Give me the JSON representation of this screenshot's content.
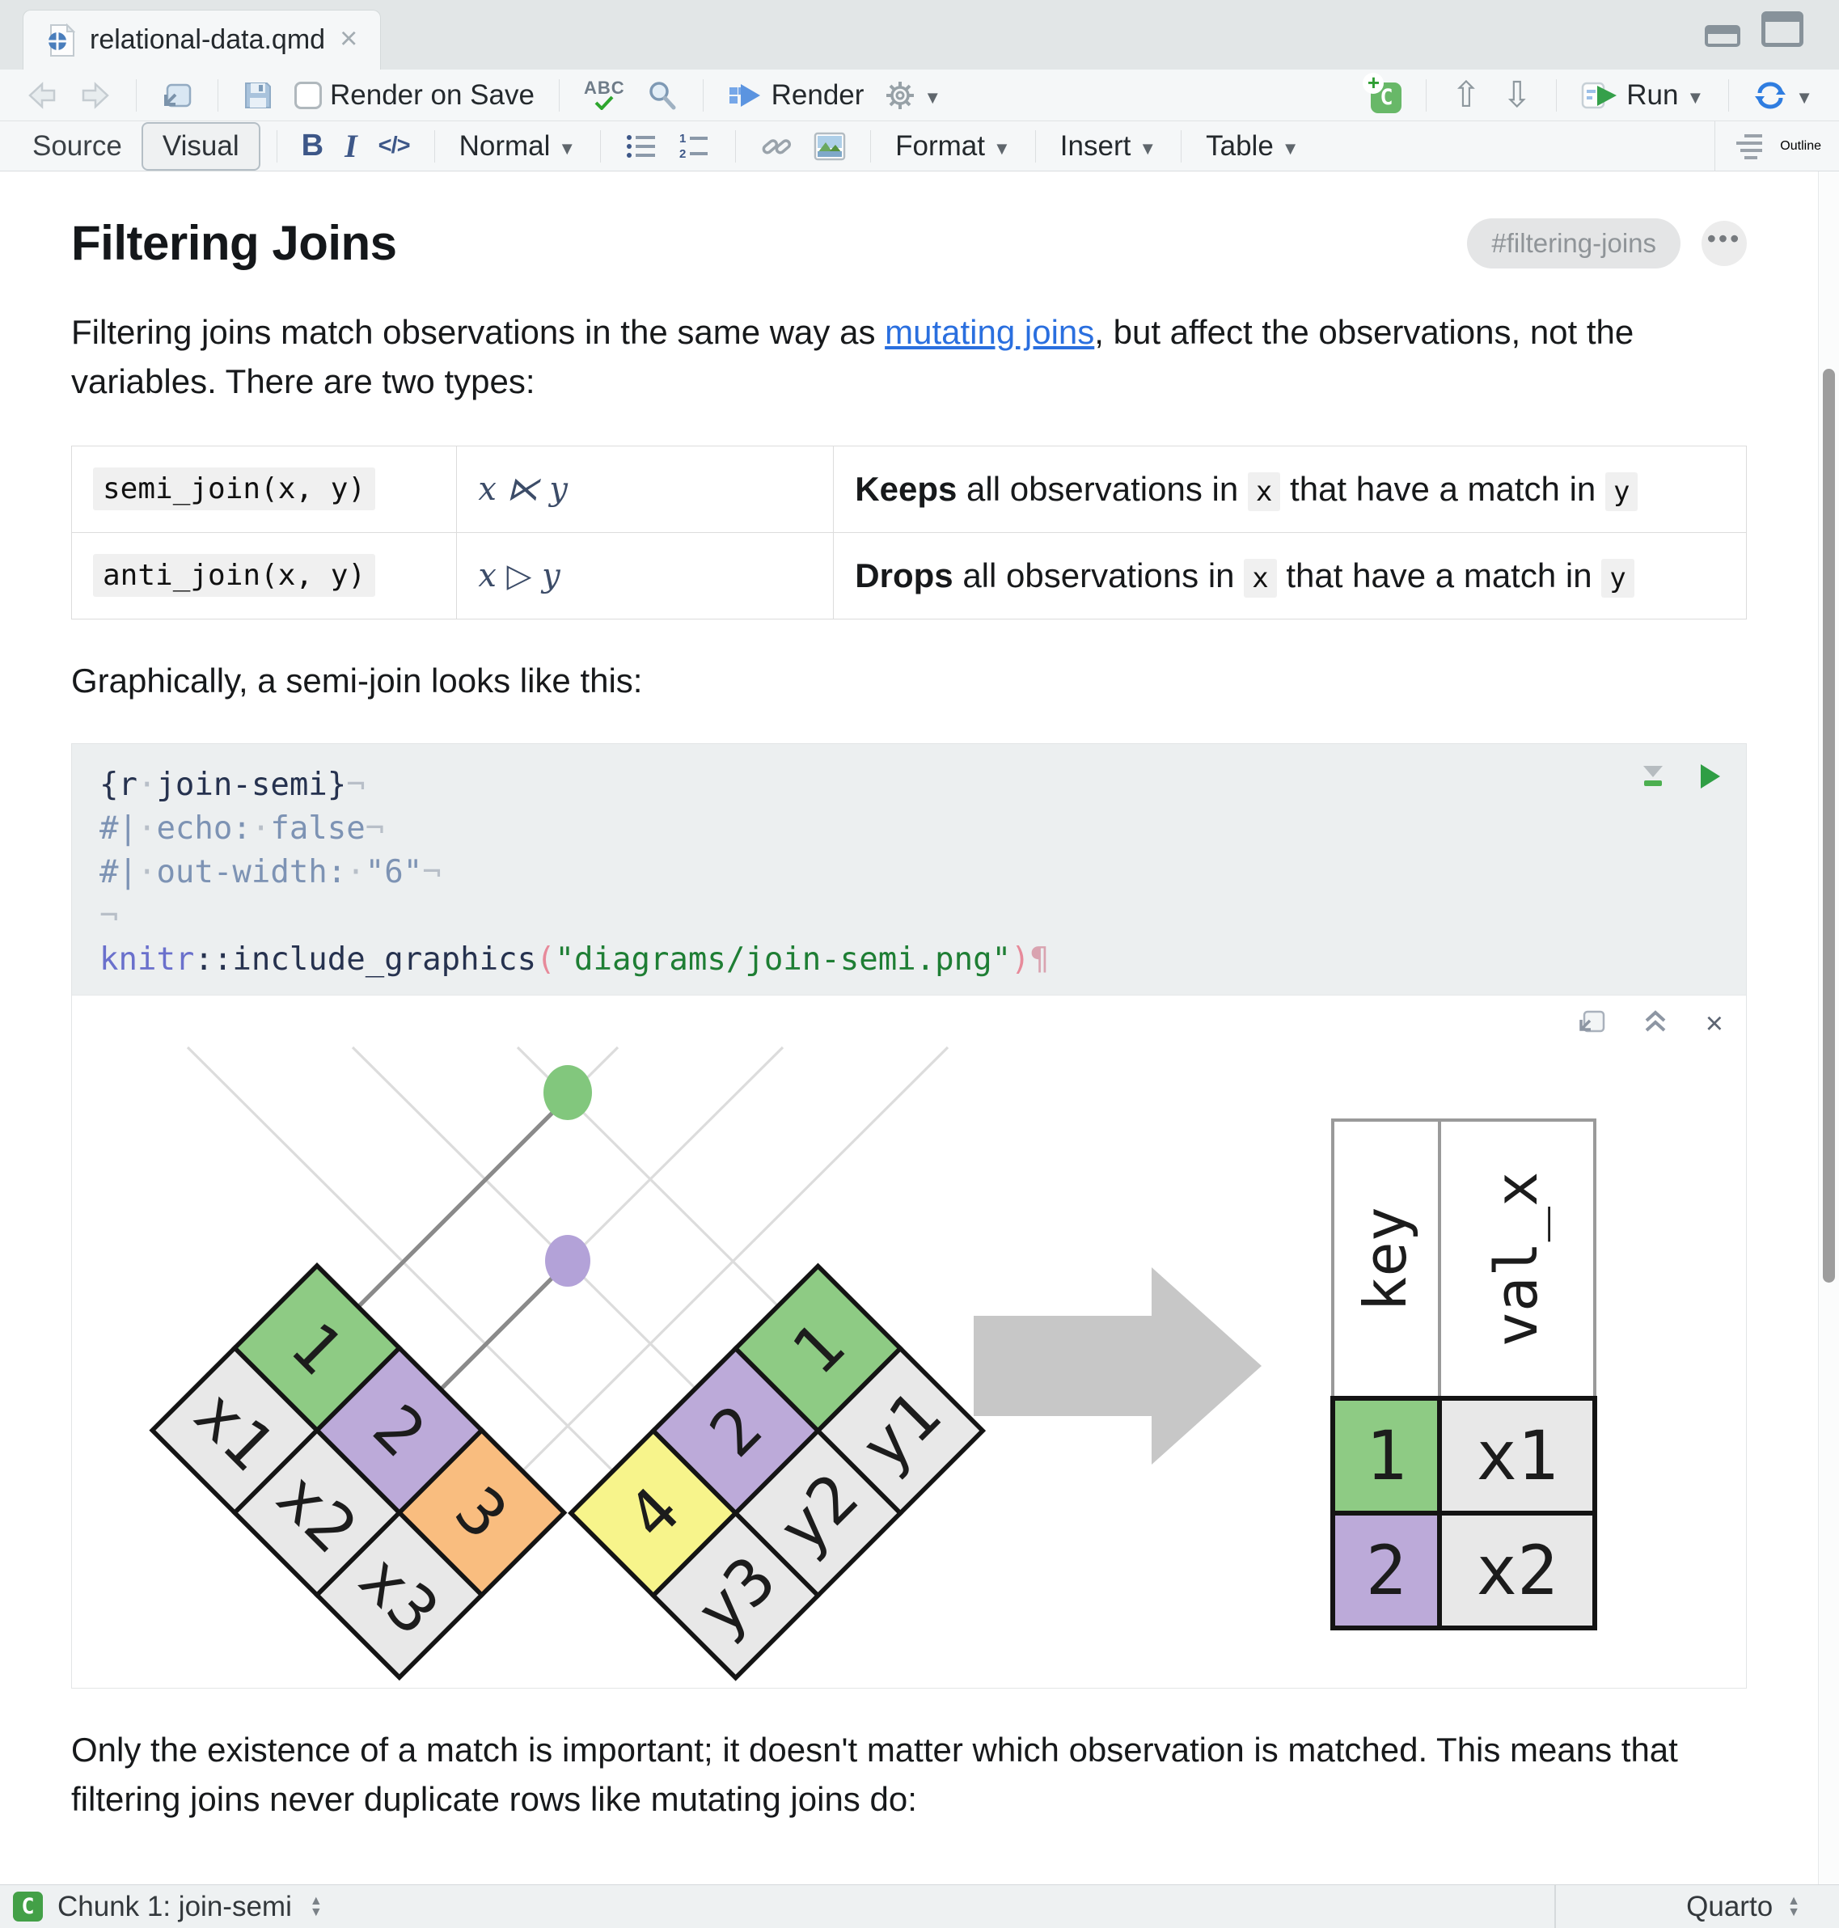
{
  "window": {
    "tab_title": "relational-data.qmd",
    "close": "×"
  },
  "toolbar": {
    "render_on_save": "Render on Save",
    "spell_abc": "ABC",
    "render": "Render",
    "run": "Run"
  },
  "format_bar": {
    "source": "Source",
    "visual": "Visual",
    "bold": "B",
    "italic": "I",
    "code": "</>",
    "normal": "Normal",
    "format": "Format",
    "insert": "Insert",
    "table": "Table",
    "outline": "Outline"
  },
  "doc": {
    "title": "Filtering Joins",
    "anchor": "#filtering-joins",
    "dots": "•••",
    "p1_before": "Filtering joins match observations in the same way as ",
    "p1_link": "mutating joins",
    "p1_after": ", but affect the observations, not the variables. There are two types:",
    "rows": [
      {
        "code": "semi_join(x, y)",
        "math": "x ⋉ y",
        "verb": "Keeps",
        "d1": " all observations in ",
        "x": "x",
        "d2": " that have a match in ",
        "y": "y"
      },
      {
        "code": "anti_join(x, y)",
        "math": "x ▷ y",
        "verb": "Drops",
        "d1": " all observations in ",
        "x": "x",
        "d2": " that have a match in ",
        "y": "y"
      }
    ],
    "p2": "Graphically, a semi-join looks like this:",
    "p3": "Only the existence of a match is important; it doesn't matter which observation is matched. This means that filtering joins never duplicate rows like mutating joins do:"
  },
  "chunk": {
    "l1": [
      "{r",
      "·",
      "join-semi}",
      "¬"
    ],
    "l2": [
      "#|",
      "·",
      "echo:",
      "·",
      "false",
      "¬"
    ],
    "l3": [
      "#|",
      "·",
      "out-width:",
      "·",
      "\"6\"",
      "¬"
    ],
    "l4": [
      "¬"
    ],
    "l5": [
      "knitr",
      "::",
      "include_graphics",
      "(",
      "\"diagrams/join-semi.png\"",
      ")",
      "¶"
    ]
  },
  "diagram": {
    "x_table": {
      "keys": [
        "1",
        "2",
        "3"
      ],
      "vals": [
        "x1",
        "x2",
        "x3"
      ]
    },
    "y_table": {
      "keys": [
        "4",
        "2",
        "1"
      ],
      "vals": [
        "y3",
        "y2",
        "y1"
      ]
    },
    "result": {
      "h1": "key",
      "h2": "val_x",
      "r1k": "1",
      "r1v": "x1",
      "r2k": "2",
      "r2v": "x2"
    },
    "colors": {
      "green": "#8ecb84",
      "purple": "#bcaad9",
      "orange": "#f9bd7f",
      "yellow": "#f7f48b",
      "cell": "#e8e8e8",
      "arrow": "#c7c7c7"
    }
  },
  "status": {
    "chunk_label": "Chunk 1: join-semi",
    "mode": "Quarto"
  }
}
